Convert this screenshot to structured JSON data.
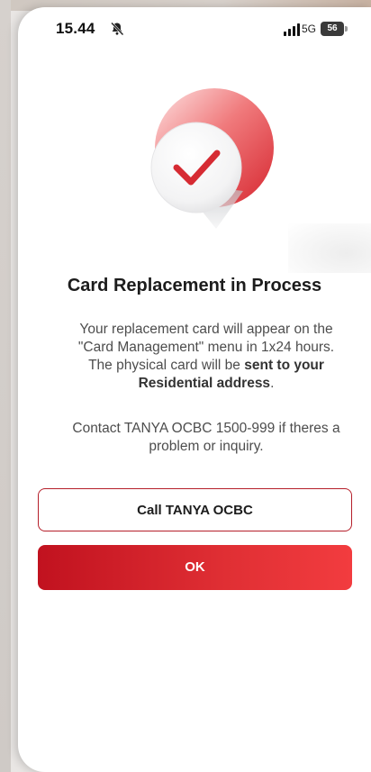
{
  "status_bar": {
    "time": "15.44",
    "network": "5G",
    "battery": "56",
    "icons": [
      "bell-off-icon",
      "signal-icon",
      "battery-icon"
    ]
  },
  "hero": {
    "icon": "checkmark-icon",
    "colors": {
      "check": "#d62b33",
      "accent_ring": "#e84b4f"
    }
  },
  "content": {
    "title": "Card Replacement in Process",
    "message_part1": "Your replacement card will appear on the \"Card Management\" menu in 1x24 hours. The physical card will be ",
    "message_bold": "sent to your Residential address",
    "message_end": ".",
    "contact": "Contact TANYA OCBC 1500-999 if theres a problem or inquiry."
  },
  "buttons": {
    "call": "Call TANYA OCBC",
    "ok": "OK"
  },
  "colors": {
    "primary": "#d7262c",
    "primary_light": "#f23c3f",
    "outline": "#b51f2a"
  }
}
